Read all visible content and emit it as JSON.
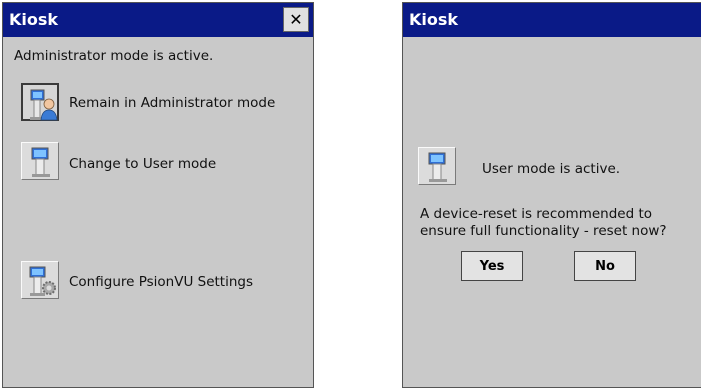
{
  "left_window": {
    "title": "Kiosk",
    "close_glyph": "✕",
    "status": "Administrator mode is active.",
    "options": [
      {
        "label": "Remain in Administrator mode",
        "icon": "administrator-kiosk-icon"
      },
      {
        "label": "Change to User mode",
        "icon": "user-kiosk-icon"
      },
      {
        "label": "Configure PsionVU Settings",
        "icon": "settings-kiosk-icon"
      }
    ]
  },
  "right_window": {
    "title": "Kiosk",
    "status": "User mode is active.",
    "status_icon": "user-kiosk-icon",
    "message_line1": "A device-reset is recommended to",
    "message_line2": "ensure full functionality - reset now?",
    "yes_label": "Yes",
    "no_label": "No"
  },
  "colors": {
    "titlebar": "#0a1a87",
    "window_bg": "#c9c9c9",
    "button_bg": "#e3e3e3"
  }
}
